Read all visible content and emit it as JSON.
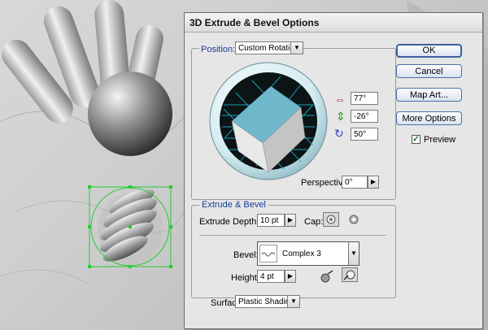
{
  "dialog": {
    "title": "3D Extrude & Bevel Options",
    "position": {
      "label": "Position:",
      "value": "Custom Rotation",
      "rotation_x": "77°",
      "rotation_y": "-26°",
      "rotation_z": "50°",
      "perspective_label": "Perspective:",
      "perspective_value": "0°"
    },
    "extrude_bevel": {
      "title": "Extrude & Bevel",
      "depth_label": "Extrude Depth:",
      "depth_value": "10 pt",
      "cap_label": "Cap:",
      "bevel_label": "Bevel:",
      "bevel_value": "Complex 3",
      "height_label": "Height:",
      "height_value": "4 pt"
    },
    "surface": {
      "label": "Surface:",
      "value": "Plastic Shading"
    },
    "buttons": {
      "ok": "OK",
      "cancel": "Cancel",
      "map_art": "Map Art...",
      "more_options": "More Options"
    },
    "preview": {
      "label": "Preview",
      "checked": true
    }
  },
  "colors": {
    "accent": "#1a3c9a",
    "cube_face": "#6fb8cc",
    "grid": "#1ab0c8"
  }
}
